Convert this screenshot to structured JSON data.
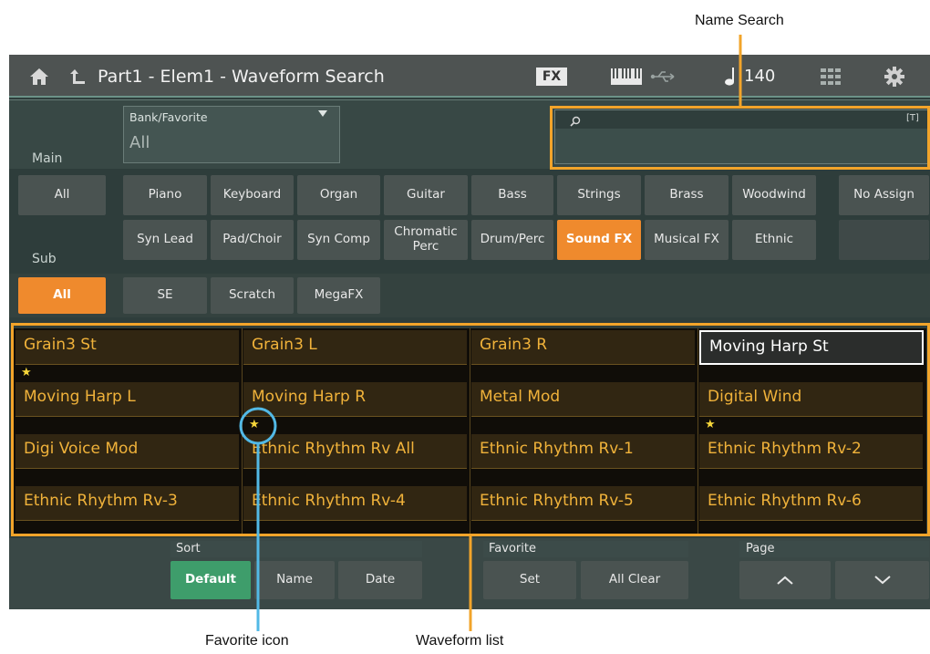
{
  "callouts": {
    "name_search": "Name Search",
    "favorite_icon": "Favorite icon",
    "waveform_list": "Waveform list"
  },
  "header": {
    "title": "Part1 - Elem1 - Waveform Search",
    "fx_label": "FX",
    "tempo": "140",
    "icons": [
      "home-icon",
      "back-icon",
      "keyboard-icon",
      "usb-icon",
      "note-icon",
      "grid-icon",
      "gear-icon"
    ]
  },
  "main": {
    "label": "Main",
    "bank_label": "Bank/Favorite",
    "bank_value": "All",
    "search_placeholder": "",
    "search_t_label": "[T]",
    "all_label": "All",
    "categories_row1": [
      "Piano",
      "Keyboard",
      "Organ",
      "Guitar",
      "Bass",
      "Strings",
      "Brass",
      "Woodwind",
      "No Assign"
    ],
    "categories_row2": [
      "Syn Lead",
      "Pad/Choir",
      "Syn Comp",
      "Chromatic Perc",
      "Drum/Perc",
      "Sound FX",
      "Musical FX",
      "Ethnic"
    ],
    "active_category": "Sound FX"
  },
  "sub": {
    "label": "Sub",
    "all_label": "All",
    "items": [
      "SE",
      "Scratch",
      "MegaFX"
    ]
  },
  "waveforms": [
    {
      "name": "Grain3 St",
      "favorite": true
    },
    {
      "name": "Grain3 L",
      "favorite": false
    },
    {
      "name": "Grain3 R",
      "favorite": false
    },
    {
      "name": "Moving Harp St",
      "favorite": false,
      "selected": true
    },
    {
      "name": "Moving Harp L",
      "favorite": false
    },
    {
      "name": "Moving Harp R",
      "favorite": true
    },
    {
      "name": "Metal Mod",
      "favorite": false
    },
    {
      "name": "Digital Wind",
      "favorite": true
    },
    {
      "name": "Digi Voice Mod",
      "favorite": false
    },
    {
      "name": "Ethnic Rhythm Rv All",
      "favorite": false
    },
    {
      "name": "Ethnic Rhythm Rv-1",
      "favorite": false
    },
    {
      "name": "Ethnic Rhythm Rv-2",
      "favorite": false
    },
    {
      "name": "Ethnic Rhythm Rv-3",
      "favorite": false
    },
    {
      "name": "Ethnic Rhythm Rv-4",
      "favorite": false
    },
    {
      "name": "Ethnic Rhythm Rv-5",
      "favorite": false
    },
    {
      "name": "Ethnic Rhythm Rv-6",
      "favorite": false
    }
  ],
  "footer": {
    "sort_label": "Sort",
    "sort_default": "Default",
    "sort_name": "Name",
    "sort_date": "Date",
    "favorite_label": "Favorite",
    "fav_set": "Set",
    "fav_all_clear": "All Clear",
    "page_label": "Page"
  },
  "colors": {
    "accent": "#ef8a2d",
    "waveform_text": "#f0b23a",
    "star": "#f6d63a",
    "sort_active": "#3e9d6b",
    "callout_orange": "#f2a42a",
    "callout_blue": "#52b9e6"
  }
}
